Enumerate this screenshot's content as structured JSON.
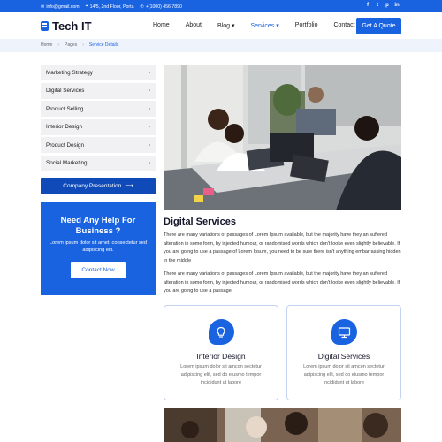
{
  "topbar": {
    "email": "info@gmail.com",
    "address": "14/5, 2nd Floor, Porta",
    "phone": "+(1000) 456 7890",
    "social": [
      "f",
      "t",
      "p",
      "in"
    ]
  },
  "nav": {
    "logo": "Tech IT",
    "items": [
      {
        "label": "Home"
      },
      {
        "label": "About"
      },
      {
        "label": "Blog"
      },
      {
        "label": "Services"
      },
      {
        "label": "Portfolio"
      },
      {
        "label": "Contact"
      }
    ],
    "quote_button": "Get A Quote"
  },
  "breadcrumb": [
    "Home",
    "Pages",
    "Service Details"
  ],
  "sidebar": {
    "items": [
      {
        "label": "Marketing Strategy"
      },
      {
        "label": "Digital Services"
      },
      {
        "label": "Product Selling"
      },
      {
        "label": "Interior Design"
      },
      {
        "label": "Product Design"
      },
      {
        "label": "Social Marketing"
      }
    ],
    "presentation_button": "Company Presentation",
    "help": {
      "title": "Need Any Help For Business ?",
      "text": "Lorem ipsum dolor sit amet, consectetur sed adipiscing elit.",
      "button": "Contact Now"
    }
  },
  "main": {
    "title": "Digital Services",
    "paragraphs": [
      "There are many variations of passages of Lorem Ipsum available, but the majority have they an suffered alteration in some form, by injected humour, or randomised words which don't looke even slightly believable. If you are going to use a passage of Lorem Ipsum, you need to be sure there isn't anything embarrassing hidden in the middle",
      "There are many variations of passages of Lorem Ipsum available, but the majority have they an suffered alteration in some form, by injected humour, or randomised words which don't looke even slightly believable. If you are going to use a passage"
    ],
    "cards": [
      {
        "title": "Interior Design",
        "text": "Lorem ipsum dolor sit amcon sectetur adipiscing elit, sed do eiusmo tempor incididunt ut labore"
      },
      {
        "title": "Digital Services",
        "text": "Lorem ipsum dolor sit amcon sectetur adipiscing elit, sed do eiusmo tempor incididunt ut labore"
      }
    ]
  },
  "colors": {
    "accent": "#1a63e0",
    "dark_accent": "#0f4ab8",
    "sidebar_bg": "#f1f1f4",
    "breadcrumb_bg": "#eef3fc"
  }
}
